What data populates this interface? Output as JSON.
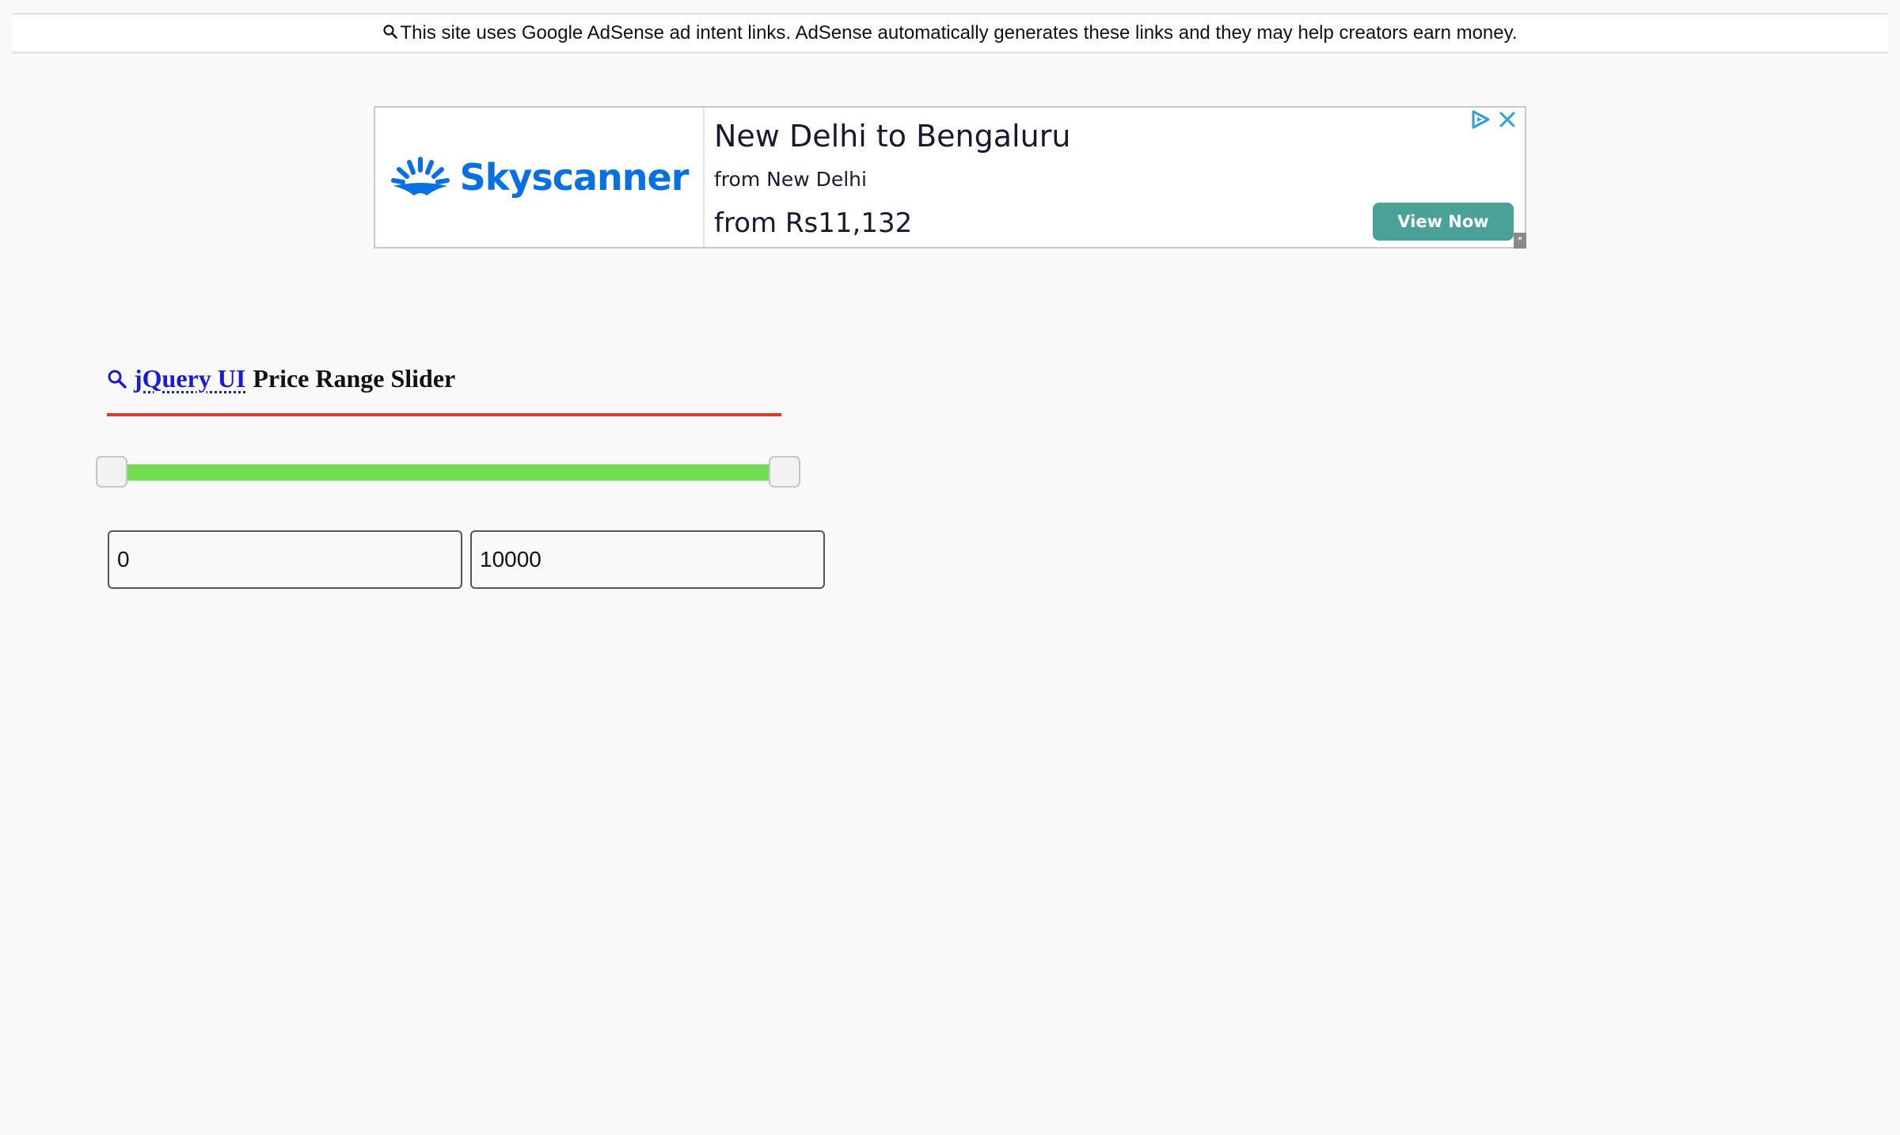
{
  "adsense_notice": {
    "icon": "search-icon",
    "text": "This site uses Google AdSense ad intent links. AdSense automatically generates these links and they may help creators earn money."
  },
  "ad": {
    "brand": "Skyscanner",
    "brand_color": "#0770e3",
    "headline": "New Delhi to Bengaluru",
    "subline": "from New Delhi",
    "price": "from Rs11,132",
    "cta_label": "View Now",
    "cta_color": "#4aa197",
    "adchoices_icon": "adchoices-play-icon",
    "close_icon": "close-icon",
    "corner_glyph": "*"
  },
  "heading": {
    "icon": "search-icon",
    "link_text": "jQuery UI",
    "rest_text": "Price Range Slider",
    "underline_color": "#e0392b"
  },
  "slider": {
    "min": 0,
    "max": 10000,
    "range_start": 0,
    "range_end": 10000,
    "range_color": "#6fde4f"
  },
  "inputs": {
    "min_value": "0",
    "max_value": "10000"
  }
}
